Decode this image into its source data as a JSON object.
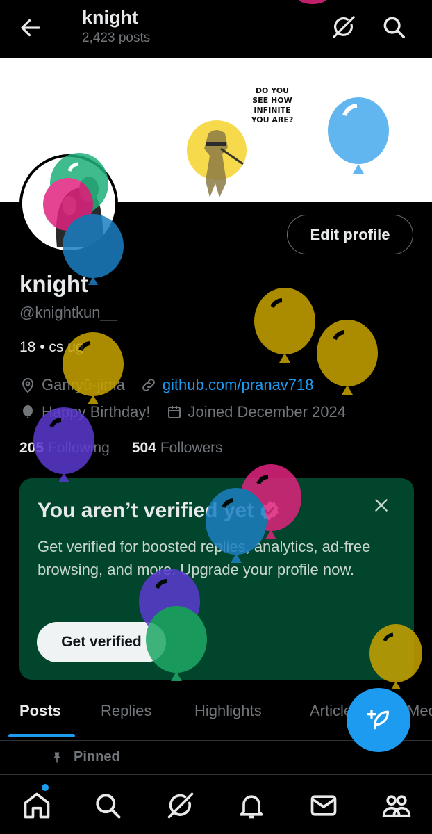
{
  "header": {
    "title": "knight",
    "post_count": "2,423 posts",
    "back_icon": "arrow-left-icon",
    "grok_icon": "grok-icon",
    "search_icon": "search-icon"
  },
  "banner": {
    "caption_lines": [
      "DO YOU",
      "SEE HOW",
      "INFINITE",
      "YOU ARE?"
    ]
  },
  "profile": {
    "edit_label": "Edit profile",
    "display_name": "knight",
    "handle": "@knightkun__",
    "bio": "18 • cs ug",
    "location": "Ganryū-jima",
    "website": "github.com/pranav718",
    "birthday": "Happy Birthday!",
    "joined": "Joined December 2024",
    "following_count": "205",
    "following_label": "Following",
    "followers_count": "504",
    "followers_label": "Followers"
  },
  "verify_card": {
    "title": "You aren’t verified yet",
    "description": "Get verified for boosted replies, analytics, ad-free browsing, and more. Upgrade your profile now.",
    "button_label": "Get verified",
    "background": "#00452c"
  },
  "tabs": [
    {
      "label": "Posts",
      "active": true
    },
    {
      "label": "Replies",
      "active": false
    },
    {
      "label": "Highlights",
      "active": false
    },
    {
      "label": "Articles",
      "active": false
    },
    {
      "label": "Media",
      "active": false
    }
  ],
  "pinned_label": "Pinned",
  "bottom_nav": [
    {
      "icon": "home-icon"
    },
    {
      "icon": "search-icon"
    },
    {
      "icon": "grok-icon"
    },
    {
      "icon": "bell-icon"
    },
    {
      "icon": "mail-icon"
    },
    {
      "icon": "communities-icon"
    }
  ],
  "colors": {
    "accent": "#1d9bf0",
    "muted": "#71767b",
    "text": "#e7e9ea"
  }
}
